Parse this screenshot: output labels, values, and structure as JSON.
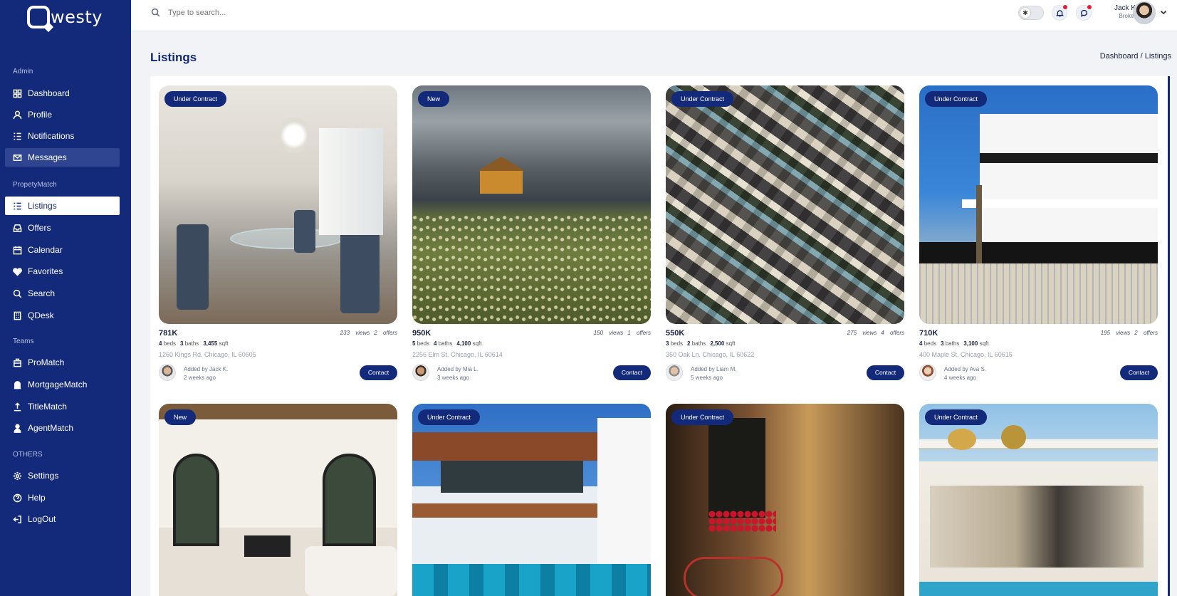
{
  "brand": {
    "name": "westy"
  },
  "sidebar": {
    "sections": [
      {
        "label": "Admin",
        "items": [
          {
            "label": "Dashboard",
            "icon": "grid-icon"
          },
          {
            "label": "Profile",
            "icon": "user-icon"
          },
          {
            "label": "Notifications",
            "icon": "list-icon"
          },
          {
            "label": "Messages",
            "icon": "mail-icon"
          }
        ]
      },
      {
        "label": "PropetyMatch",
        "items": [
          {
            "label": "Listings",
            "icon": "list-icon"
          },
          {
            "label": "Offers",
            "icon": "tray-icon"
          },
          {
            "label": "Calendar",
            "icon": "calendar-icon"
          },
          {
            "label": "Favorites",
            "icon": "heart-icon"
          },
          {
            "label": "Search",
            "icon": "search-icon"
          },
          {
            "label": "QDesk",
            "icon": "building-icon"
          }
        ]
      },
      {
        "label": "Teams",
        "items": [
          {
            "label": "ProMatch",
            "icon": "transfer-icon"
          },
          {
            "label": "MortgageMatch",
            "icon": "bank-icon"
          },
          {
            "label": "TitleMatch",
            "icon": "upload-icon"
          },
          {
            "label": "AgentMatch",
            "icon": "person-icon"
          }
        ]
      },
      {
        "label": "OTHERS",
        "items": [
          {
            "label": "Settings",
            "icon": "gear-icon"
          },
          {
            "label": "Help",
            "icon": "help-icon"
          },
          {
            "label": "LogOut",
            "icon": "logout-icon"
          }
        ]
      }
    ]
  },
  "topbar": {
    "search_placeholder": "Type to search...",
    "user": {
      "name": "Jack K",
      "role": "Broker"
    }
  },
  "page": {
    "title": "Listings",
    "breadcrumb": "Dashboard /  Listings"
  },
  "labels": {
    "beds": "beds",
    "baths": "baths",
    "sqft": "sqft",
    "views": "views",
    "offers": "offers",
    "contact": "Contact"
  },
  "listings": [
    {
      "badge": "Under Contract",
      "price": "781K",
      "views": "233",
      "offers": "2",
      "beds": "4",
      "baths": "3",
      "sqft": "3,455",
      "address": "1260 Kings Rd. Chicago, IL 60605",
      "added_by": "Added by Jack K.",
      "added_when": "2 weeks ago"
    },
    {
      "badge": "New",
      "price": "950K",
      "views": "150",
      "offers": "1",
      "beds": "5",
      "baths": "4",
      "sqft": "4,100",
      "address": "2256 Elm St. Chicago, IL 60614",
      "added_by": "Added by Mia L.",
      "added_when": "3 weeks ago"
    },
    {
      "badge": "Under Contract",
      "price": "550K",
      "views": "275",
      "offers": "4",
      "beds": "3",
      "baths": "2",
      "sqft": "2,500",
      "address": "350 Oak Ln. Chicago, IL 60622",
      "added_by": "Added by Liam M.",
      "added_when": "5 weeks ago"
    },
    {
      "badge": "Under Contract",
      "price": "710K",
      "views": "195",
      "offers": "2",
      "beds": "4",
      "baths": "3",
      "sqft": "3,100",
      "address": "400 Maple St. Chicago, IL 60615",
      "added_by": "Added by Ava S.",
      "added_when": "4 weeks ago"
    },
    {
      "badge": "New"
    },
    {
      "badge": "Under Contract"
    },
    {
      "badge": "Under Contract"
    },
    {
      "badge": "Under Contract"
    }
  ]
}
